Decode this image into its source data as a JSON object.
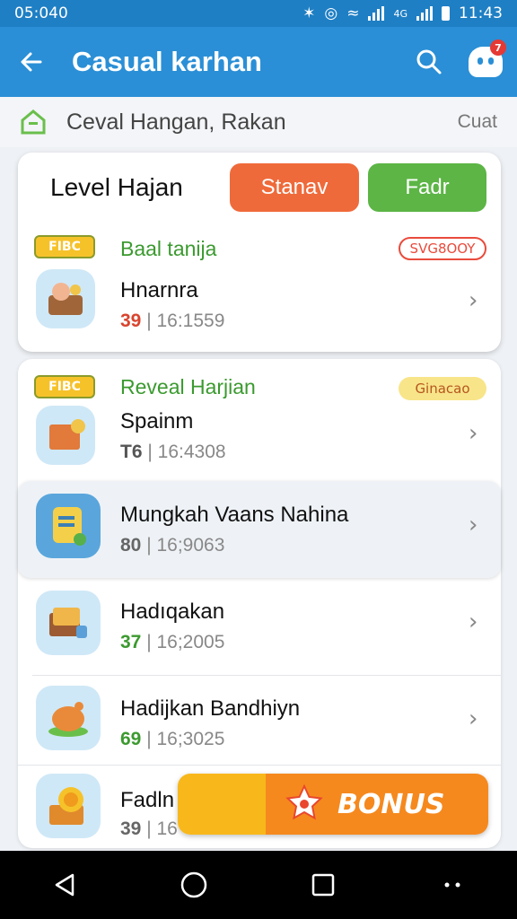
{
  "status": {
    "time_left": "05:040",
    "time_right": "11:43",
    "net_label": "4G"
  },
  "appbar": {
    "title": "Casual karhan",
    "badge": "7"
  },
  "crumb": {
    "text": "Ceval Hangan, Rakan",
    "side": "Cuat"
  },
  "card": {
    "heading": "Level Hajan",
    "btn_orange": "Stanav",
    "btn_green": "Fadr",
    "item": {
      "tag": "FIBC",
      "category": "Baal tanija",
      "chip": "SVG8OOY",
      "title": "Hnarnra",
      "num": "39",
      "meta": "| 16:1559"
    }
  },
  "rows": [
    {
      "tag": "FIBC",
      "category": "Reveal Harjian",
      "chip": "Ginacao",
      "title": "Spainm",
      "num": "T6",
      "meta": "| 16:4308"
    },
    {
      "title": "Mungkah Vaans Nahina",
      "num": "80",
      "meta": "| 16;9063"
    },
    {
      "title": "Hadıqakan",
      "num": "37",
      "meta": "| 16;2005"
    },
    {
      "title": "Hadijkan Bandhiyn",
      "num": "69",
      "meta": "| 16;3025"
    },
    {
      "title": "Fadln",
      "num": "39",
      "meta": "| 16"
    }
  ],
  "bonus": {
    "label": "BONUS"
  },
  "colors": {
    "primary": "#2a8fd6",
    "status": "#1f7fc4",
    "accent_orange": "#ef6a3a",
    "accent_green": "#5cb545",
    "bonus": "#f5891e"
  }
}
